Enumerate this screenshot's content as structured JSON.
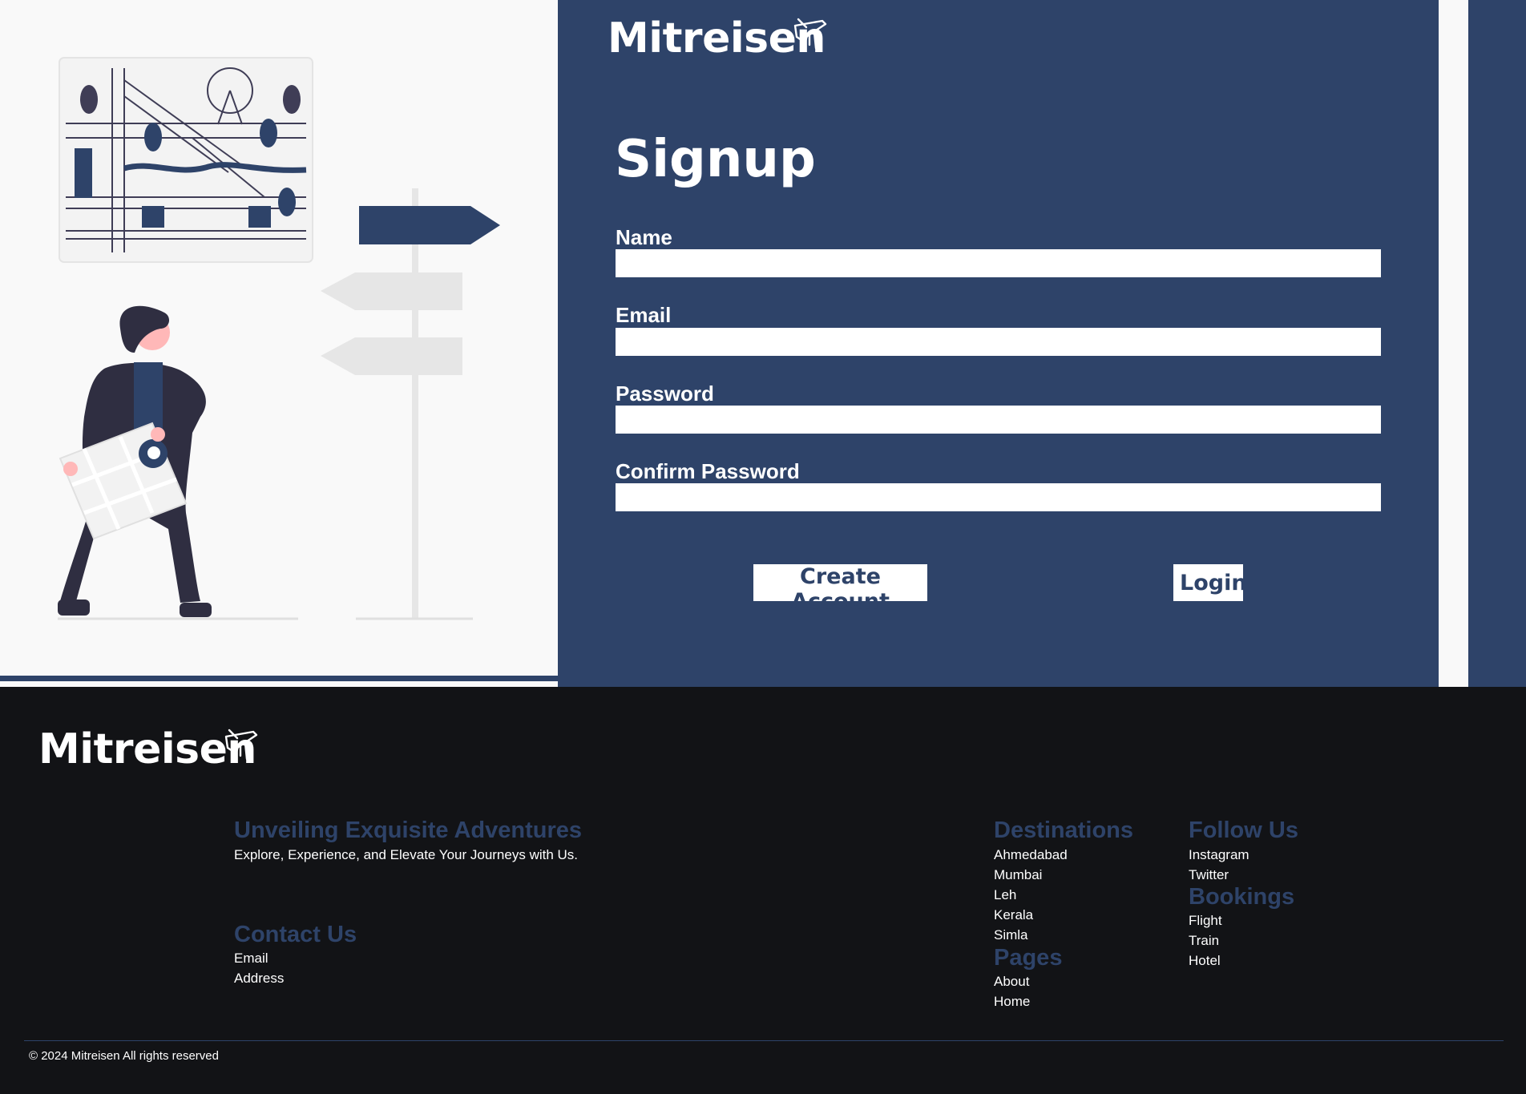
{
  "brand": {
    "name": "Mitreisen"
  },
  "signup": {
    "title": "Signup",
    "fields": [
      {
        "label": "Name",
        "value": ""
      },
      {
        "label": "Email",
        "value": ""
      },
      {
        "label": "Password",
        "value": ""
      },
      {
        "label": "Confirm Password",
        "value": ""
      }
    ],
    "create_button": "Create Account",
    "login_button": "Login"
  },
  "footer": {
    "about": {
      "heading": "Unveiling Exquisite Adventures",
      "text": "Explore, Experience, and Elevate Your Journeys with Us."
    },
    "contact": {
      "heading": "Contact Us",
      "items": [
        "Email",
        "Address"
      ]
    },
    "destinations": {
      "heading": "Destinations",
      "items": [
        "Ahmedabad",
        "Mumbai",
        "Leh",
        "Kerala",
        "Simla"
      ]
    },
    "pages": {
      "heading": "Pages",
      "items": [
        "About",
        "Home"
      ]
    },
    "follow": {
      "heading": "Follow Us",
      "items": [
        "Instagram",
        "Twitter"
      ]
    },
    "bookings": {
      "heading": "Bookings",
      "items": [
        "Flight",
        "Train",
        "Hotel"
      ]
    },
    "copyright": "© 2024 Mitreisen All rights reserved"
  },
  "colors": {
    "primary": "#2e4369",
    "footer_bg": "#121316",
    "page_bg": "#f9f9f9",
    "illustration_skin": "#ffb8b8"
  },
  "icons": {
    "logo_plane": "airplane-icon"
  }
}
